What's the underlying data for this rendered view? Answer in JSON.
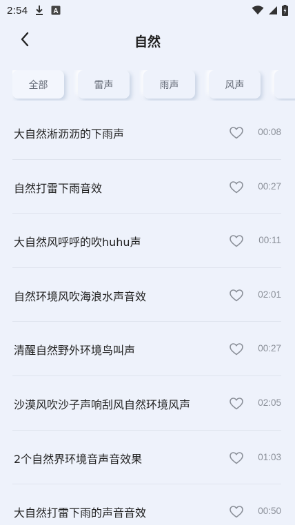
{
  "status_bar": {
    "time": "2:54",
    "icons": [
      "download-icon",
      "font-a-icon",
      "wifi-icon",
      "signal-icon",
      "battery-charging-icon"
    ],
    "badge_letter": "A"
  },
  "header": {
    "title": "自然",
    "back_icon": "chevron-left-icon"
  },
  "tabs": [
    {
      "label": "全部",
      "active": true
    },
    {
      "label": "雷声",
      "active": false
    },
    {
      "label": "雨声",
      "active": false
    },
    {
      "label": "风声",
      "active": false
    },
    {
      "label": "",
      "active": false
    }
  ],
  "sounds": [
    {
      "title": "大自然淅沥沥的下雨声",
      "duration": "00:08"
    },
    {
      "title": "自然打雷下雨音效",
      "duration": "00:27"
    },
    {
      "title": "大自然风呼呼的吹huhu声",
      "duration": "00:11"
    },
    {
      "title": "自然环境风吹海浪水声音效",
      "duration": "02:01"
    },
    {
      "title": "清醒自然野外环境鸟叫声",
      "duration": "00:27"
    },
    {
      "title": "沙漠风吹沙子声响刮风自然环境风声",
      "duration": "02:05"
    },
    {
      "title": "2个自然界环境音声音效果",
      "duration": "01:03"
    },
    {
      "title": "大自然打雷下雨的声音音效",
      "duration": "00:50"
    }
  ],
  "colors": {
    "background": "#eef2fb",
    "text": "#222222",
    "muted": "#8a8f98",
    "divider": "#dfe4ee"
  }
}
